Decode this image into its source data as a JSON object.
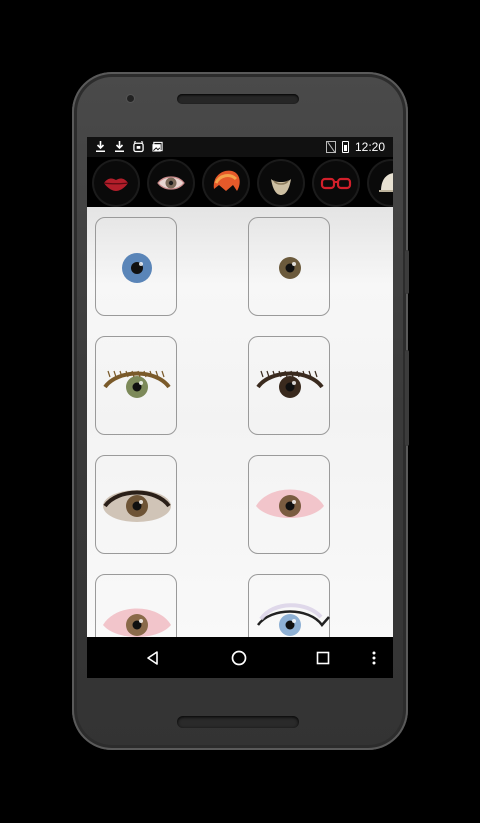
{
  "status_bar": {
    "time": "12:20",
    "left_icons": [
      "download-icon",
      "download-icon",
      "alarm-icon",
      "gallery-icon"
    ],
    "right_icons": [
      "no-sim-icon",
      "battery-icon"
    ]
  },
  "categories": [
    {
      "name": "lips",
      "icon": "lips-icon",
      "selected": false
    },
    {
      "name": "eye",
      "icon": "eye-icon",
      "selected": true
    },
    {
      "name": "hair",
      "icon": "hair-icon",
      "selected": false
    },
    {
      "name": "beard",
      "icon": "beard-icon",
      "selected": false
    },
    {
      "name": "glasses",
      "icon": "glasses-icon",
      "selected": false
    },
    {
      "name": "more",
      "icon": "hat-icon",
      "selected": false
    }
  ],
  "eye_styles": [
    {
      "iris": "#5a85b8",
      "lid": "plain",
      "rim": "#c98a86"
    },
    {
      "iris": "#6b5a3c",
      "lid": "red-rim",
      "rim": "#c23a3a"
    },
    {
      "iris": "#7d8a5a",
      "lid": "lashes-brown",
      "rim": "#7a5a2a"
    },
    {
      "iris": "#3a2a1e",
      "lid": "lashes-dark",
      "rim": "#3a2a1e"
    },
    {
      "iris": "#6e5436",
      "lid": "smoky",
      "rim": "#4a3a2a"
    },
    {
      "iris": "#7a5c40",
      "lid": "pink",
      "rim": "#e6a0a8"
    },
    {
      "iris": "#8a6a4a",
      "lid": "pink",
      "rim": "#e6a0a8"
    },
    {
      "iris": "#8eb0d4",
      "lid": "winged",
      "rim": "#222222"
    }
  ],
  "nav": {
    "buttons": [
      "back-icon",
      "home-icon",
      "recents-icon",
      "overflow-icon"
    ]
  },
  "colors": {
    "background": "#000000",
    "accent": "#c23a3a"
  }
}
